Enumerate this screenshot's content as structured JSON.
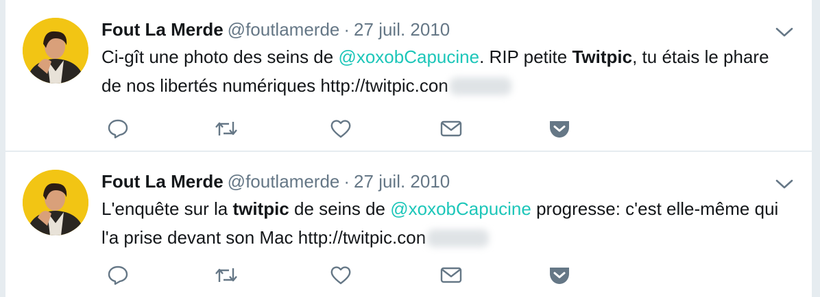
{
  "icons": {
    "reply": "reply-icon",
    "retweet": "retweet-icon",
    "like": "heart-icon",
    "dm": "envelope-icon",
    "pocket": "pocket-icon",
    "caret": "chevron-down-icon"
  },
  "colors": {
    "mention": "#1dc6b9",
    "secondary_text": "#657786",
    "icon": "#657786",
    "avatar_bg": "#f2c514"
  },
  "tweets": [
    {
      "author_name": "Fout La Merde",
      "author_handle": "@foutlamerde",
      "separator": "·",
      "date": "27 juil. 2010",
      "text": {
        "p1": "Ci-gît une photo des seins de ",
        "mention": "@xoxobCapucine",
        "p2": ". RIP petite ",
        "bold": "Twitpic",
        "p3": ", tu étais le phare de nos libertés numériques ",
        "link": "http://twitpic.con"
      }
    },
    {
      "author_name": "Fout La Merde",
      "author_handle": "@foutlamerde",
      "separator": "·",
      "date": "27 juil. 2010",
      "text": {
        "p1": "L'enquête sur la ",
        "bold": "twitpic",
        "p2": " de seins de ",
        "mention": "@xoxobCapucine",
        "p3": " progresse: c'est elle-même qui l'a prise devant son Mac  ",
        "link": "http://twitpic.con"
      }
    }
  ]
}
